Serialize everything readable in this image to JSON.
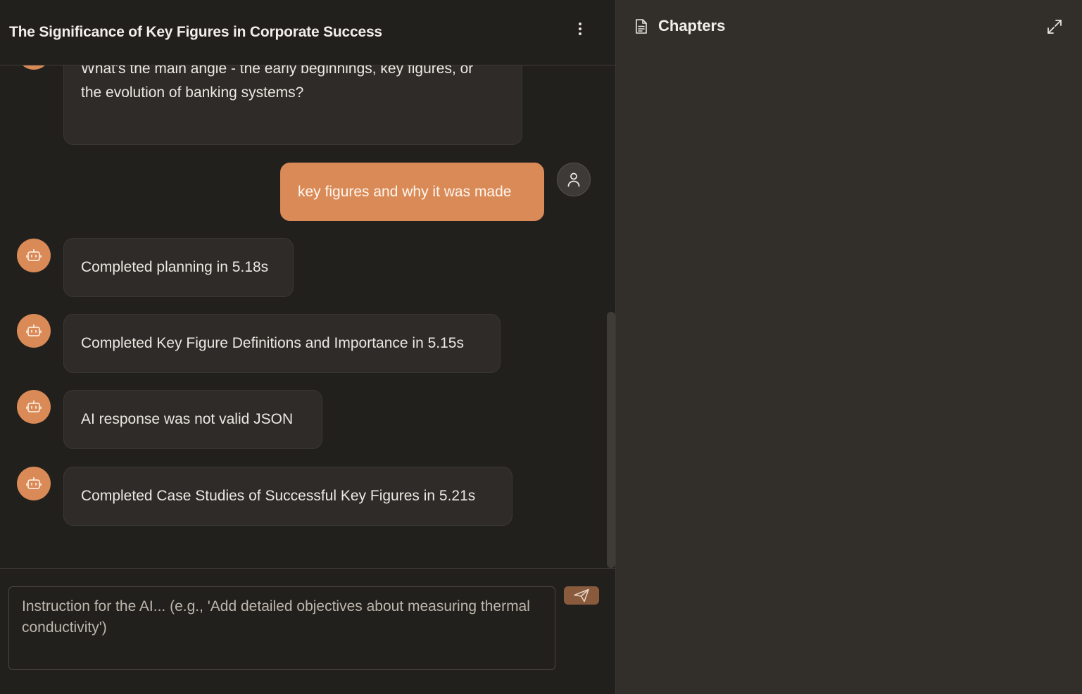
{
  "chat": {
    "title": "The Significance of Key Figures in Corporate Success",
    "menu_icon": "kebab-menu-icon",
    "messages": [
      {
        "role": "assistant",
        "text_line1": "What's the main angle - the early beginnings, key figures, or",
        "text_line2": "the evolution of banking systems?"
      },
      {
        "role": "user",
        "text": "key figures and why it was made"
      },
      {
        "role": "assistant",
        "text": "Completed planning in 5.18s"
      },
      {
        "role": "assistant",
        "text": "Completed Key Figure Definitions and Importance in 5.15s"
      },
      {
        "role": "assistant",
        "text": "AI response was not valid JSON"
      },
      {
        "role": "assistant",
        "text": "Completed Case Studies of Successful Key Figures in 5.21s"
      }
    ],
    "composer": {
      "placeholder": "Instruction for the AI... (e.g., 'Add detailed objectives about measuring thermal conductivity')",
      "value": "",
      "send_icon": "send-icon"
    }
  },
  "chapters": {
    "title": "Chapters",
    "title_icon": "document-icon",
    "expand_icon": "expand-icon"
  },
  "colors": {
    "accent": "#d98a57",
    "chat_bg": "#22201d",
    "panel_bg": "#322e2a",
    "bubble_bg": "#2e2b28"
  }
}
